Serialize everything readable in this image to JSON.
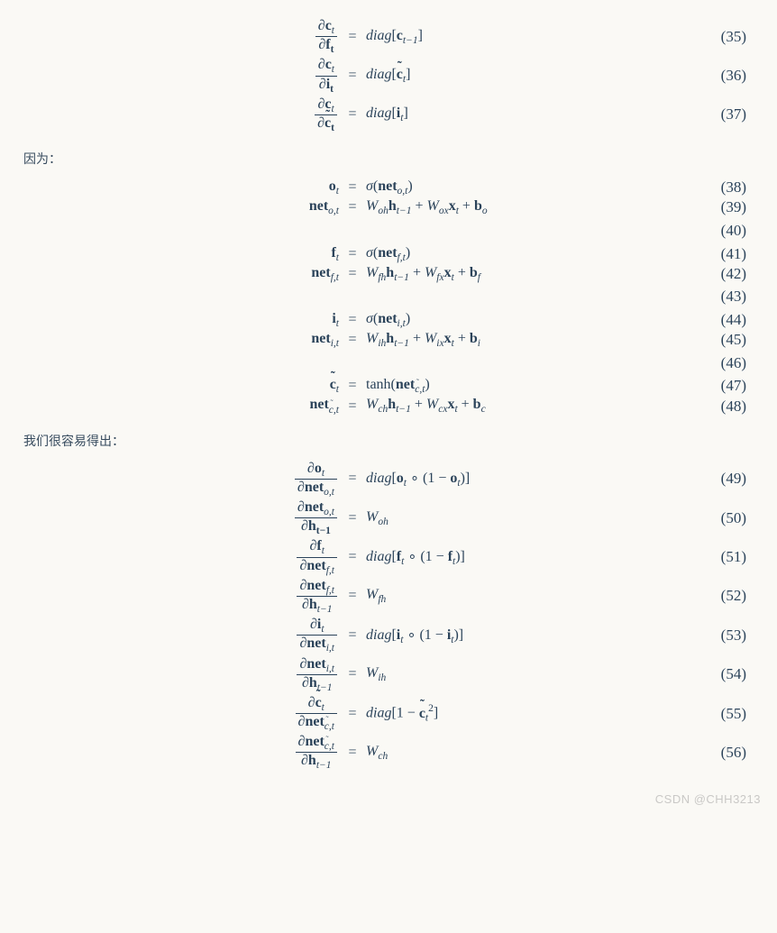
{
  "narr": {
    "t1": "因为：",
    "t2": "我们很容易得出："
  },
  "eq": {
    "35": {
      "lhs_num": "∂c",
      "lhs_num_sub": "t",
      "lhs_den": "∂f",
      "lhs_den_sub": "t",
      "rhs_pre": "diag[",
      "rhs_sym": "c",
      "rhs_sub": "t−1",
      "rhs_post": "]",
      "num": "(35)"
    },
    "36": {
      "lhs_num": "∂c",
      "lhs_num_sub": "t",
      "lhs_den": "∂i",
      "lhs_den_sub": "t",
      "rhs_pre": "diag[",
      "rhs_sym": "c̃",
      "rhs_sub": "t",
      "rhs_post": "]",
      "num": "(36)"
    },
    "37": {
      "lhs_num": "∂c",
      "lhs_num_sub": "t",
      "lhs_den": "∂c̃",
      "lhs_den_sub": "t",
      "rhs_pre": "diag[",
      "rhs_sym": "i",
      "rhs_sub": "t",
      "rhs_post": "]",
      "num": "(37)"
    },
    "38": {
      "lhs_sym": "o",
      "lhs_sub": "t",
      "rhs": "σ(net_{o,t})",
      "num": "(38)"
    },
    "39": {
      "lhs_sym": "net",
      "lhs_sub": "o,t",
      "w1": "W",
      "w1s": "oh",
      "h": "h",
      "hs": "t−1",
      "w2": "W",
      "w2s": "ox",
      "x": "x",
      "xs": "t",
      "b": "b",
      "bs": "o",
      "num": "(39)"
    },
    "40": {
      "num": "(40)"
    },
    "41": {
      "lhs_sym": "f",
      "lhs_sub": "t",
      "rhs": "σ(net_{f,t})",
      "num": "(41)"
    },
    "42": {
      "lhs_sym": "net",
      "lhs_sub": "f,t",
      "w1": "W",
      "w1s": "fh",
      "h": "h",
      "hs": "t−1",
      "w2": "W",
      "w2s": "fx",
      "x": "x",
      "xs": "t",
      "b": "b",
      "bs": "f",
      "num": "(42)"
    },
    "43": {
      "num": "(43)"
    },
    "44": {
      "lhs_sym": "i",
      "lhs_sub": "t",
      "rhs": "σ(net_{i,t})",
      "num": "(44)"
    },
    "45": {
      "lhs_sym": "net",
      "lhs_sub": "i,t",
      "w1": "W",
      "w1s": "ih",
      "h": "h",
      "hs": "t−1",
      "w2": "W",
      "w2s": "ix",
      "x": "x",
      "xs": "t",
      "b": "b",
      "bs": "i",
      "num": "(45)"
    },
    "46": {
      "num": "(46)"
    },
    "47": {
      "lhs_sym": "c̃",
      "lhs_sub": "t",
      "rhs": "tanh(net_{c̃,t})",
      "num": "(47)"
    },
    "48": {
      "lhs_sym": "net",
      "lhs_sub": "c̃,t",
      "w1": "W",
      "w1s": "ch",
      "h": "h",
      "hs": "t−1",
      "w2": "W",
      "w2s": "cx",
      "x": "x",
      "xs": "t",
      "b": "b",
      "bs": "c",
      "num": "(48)"
    },
    "49": {
      "num_top": "∂o",
      "num_top_sub": "t",
      "num_bot": "∂net",
      "num_bot_sub": "o,t",
      "rhs_sym": "o",
      "rhs_sub": "t",
      "num": "(49)"
    },
    "50": {
      "num_top": "∂net",
      "num_top_sub": "o,t",
      "num_bot": "∂h",
      "num_bot_sub": "t−1",
      "rhs_w": "W",
      "rhs_ws": "oh",
      "num": "(50)"
    },
    "51": {
      "num_top": "∂f",
      "num_top_sub": "t",
      "num_bot": "∂net",
      "num_bot_sub": "f,t",
      "rhs_sym": "f",
      "rhs_sub": "t",
      "num": "(51)"
    },
    "52": {
      "num_top": "∂net",
      "num_top_sub": "f,t",
      "num_bot": "∂h",
      "num_bot_sub": "t−1",
      "rhs_w": "W",
      "rhs_ws": "fh",
      "num": "(52)"
    },
    "53": {
      "num_top": "∂i",
      "num_top_sub": "t",
      "num_bot": "∂net",
      "num_bot_sub": "i,t",
      "rhs_sym": "i",
      "rhs_sub": "t",
      "num": "(53)"
    },
    "54": {
      "num_top": "∂net",
      "num_top_sub": "i,t",
      "num_bot": "∂h",
      "num_bot_sub": "t−1",
      "rhs_w": "W",
      "rhs_ws": "ih",
      "num": "(54)"
    },
    "55": {
      "num_top": "∂c̃",
      "num_top_sub": "t",
      "num_bot": "∂net",
      "num_bot_sub": "c̃,t",
      "rhs_sym": "c̃",
      "rhs_sub": "t",
      "num": "(55)"
    },
    "56": {
      "num_top": "∂net",
      "num_top_sub": "c̃,t",
      "num_bot": "∂h",
      "num_bot_sub": "t−1",
      "rhs_w": "W",
      "rhs_ws": "ch",
      "num": "(56)"
    }
  },
  "tokens": {
    "eq": "=",
    "diag": "diag",
    "plus": " + ",
    "sigma": "σ",
    "tanh": "tanh",
    "lpar": "(",
    "rpar": ")",
    "lbrack": "[",
    "rbrack": "]",
    "partial": "∂",
    "one": "1",
    "minus": " − ",
    "circ": " ∘ "
  },
  "watermark": "CSDN @CHH3213"
}
